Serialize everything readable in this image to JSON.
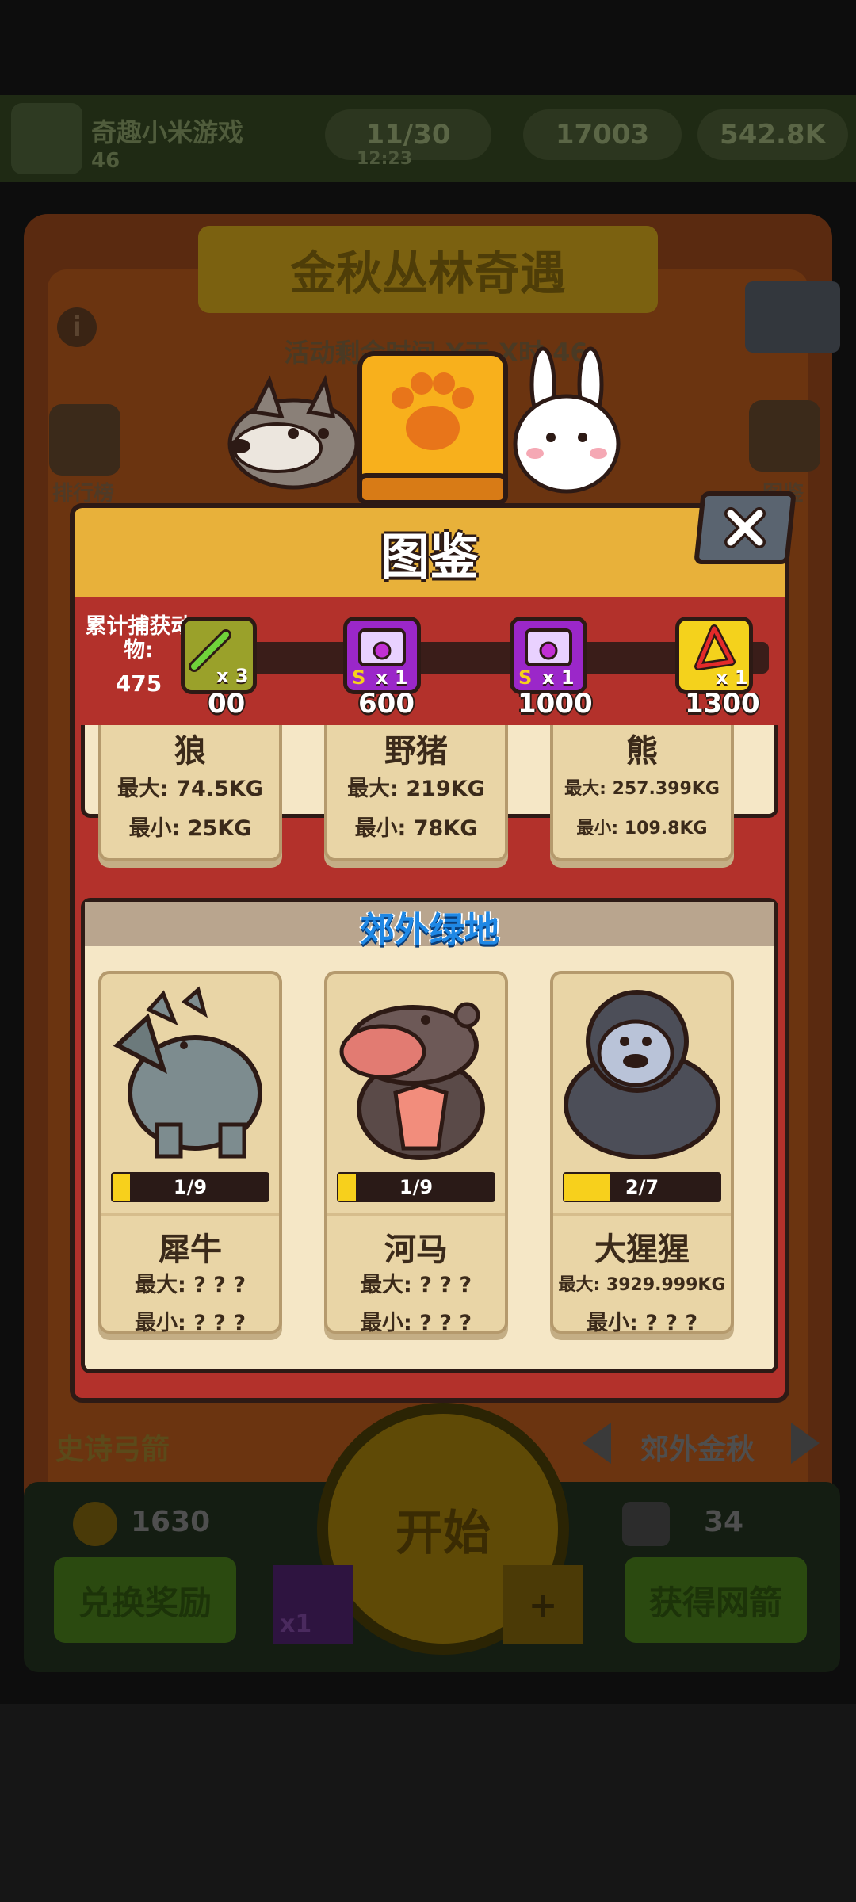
{
  "background": {
    "player_name": "奇趣小米游戏",
    "player_level": "46",
    "energy": "11/30",
    "energy_timer": "12:23",
    "currency_green": "17003",
    "currency_money": "542.8K",
    "event_title": "金秋丛林奇遇",
    "event_countdown": "活动剩余时间 X天 X时 46分",
    "side_left_label": "排行榜",
    "side_right_label": "图鉴",
    "weapon_label": "史诗弓箭",
    "map_name": "郊外金秋",
    "coin_count": "1630",
    "arrow_count": "34",
    "start_label": "开始",
    "exchange_label": "兑换奖励",
    "get_net_label": "获得网箭",
    "multiplier_label": "x1",
    "plus_label": "+"
  },
  "modal": {
    "title": "图鉴",
    "capture_label": "累计捕获动物:",
    "capture_count": "475",
    "progress_fraction": 0.05,
    "rewards": [
      {
        "tier": "300",
        "tier_display": "00",
        "qty": "x 3",
        "color": "#9aa12a",
        "icon": "arrow-icon"
      },
      {
        "tier": "600",
        "tier_display": "600",
        "qty": "x 1",
        "color": "#9b27c9",
        "icon": "s-chest-icon"
      },
      {
        "tier": "1000",
        "tier_display": "1000",
        "qty": "x 1",
        "color": "#9b27c9",
        "icon": "s-chest-icon"
      },
      {
        "tier": "1300",
        "tier_display": "1300",
        "qty": "x 1",
        "color": "#f4d21c",
        "icon": "red-net-icon"
      }
    ]
  },
  "sections": {
    "previous": {
      "animals": [
        {
          "name": "狼",
          "max": "最大: 74.5KG",
          "min": "最小: 25KG"
        },
        {
          "name": "野猪",
          "max": "最大: 219KG",
          "min": "最小: 78KG"
        },
        {
          "name": "熊",
          "max": "最大: 257.399KG",
          "min": "最小: 109.8KG"
        }
      ]
    },
    "suburb_green": {
      "title": "郊外绿地",
      "animals": [
        {
          "name": "犀牛",
          "progress": "1/9",
          "fraction": 0.111,
          "max": "最大: ? ? ?",
          "min": "最小: ? ? ?",
          "icon": "rhino-icon"
        },
        {
          "name": "河马",
          "progress": "1/9",
          "fraction": 0.111,
          "max": "最大: ? ? ?",
          "min": "最小: ? ? ?",
          "icon": "hippo-icon"
        },
        {
          "name": "大猩猩",
          "progress": "2/7",
          "fraction": 0.286,
          "max": "最大: 3929.999KG",
          "min": "最小: ? ? ?",
          "icon": "gorilla-icon"
        }
      ]
    }
  }
}
